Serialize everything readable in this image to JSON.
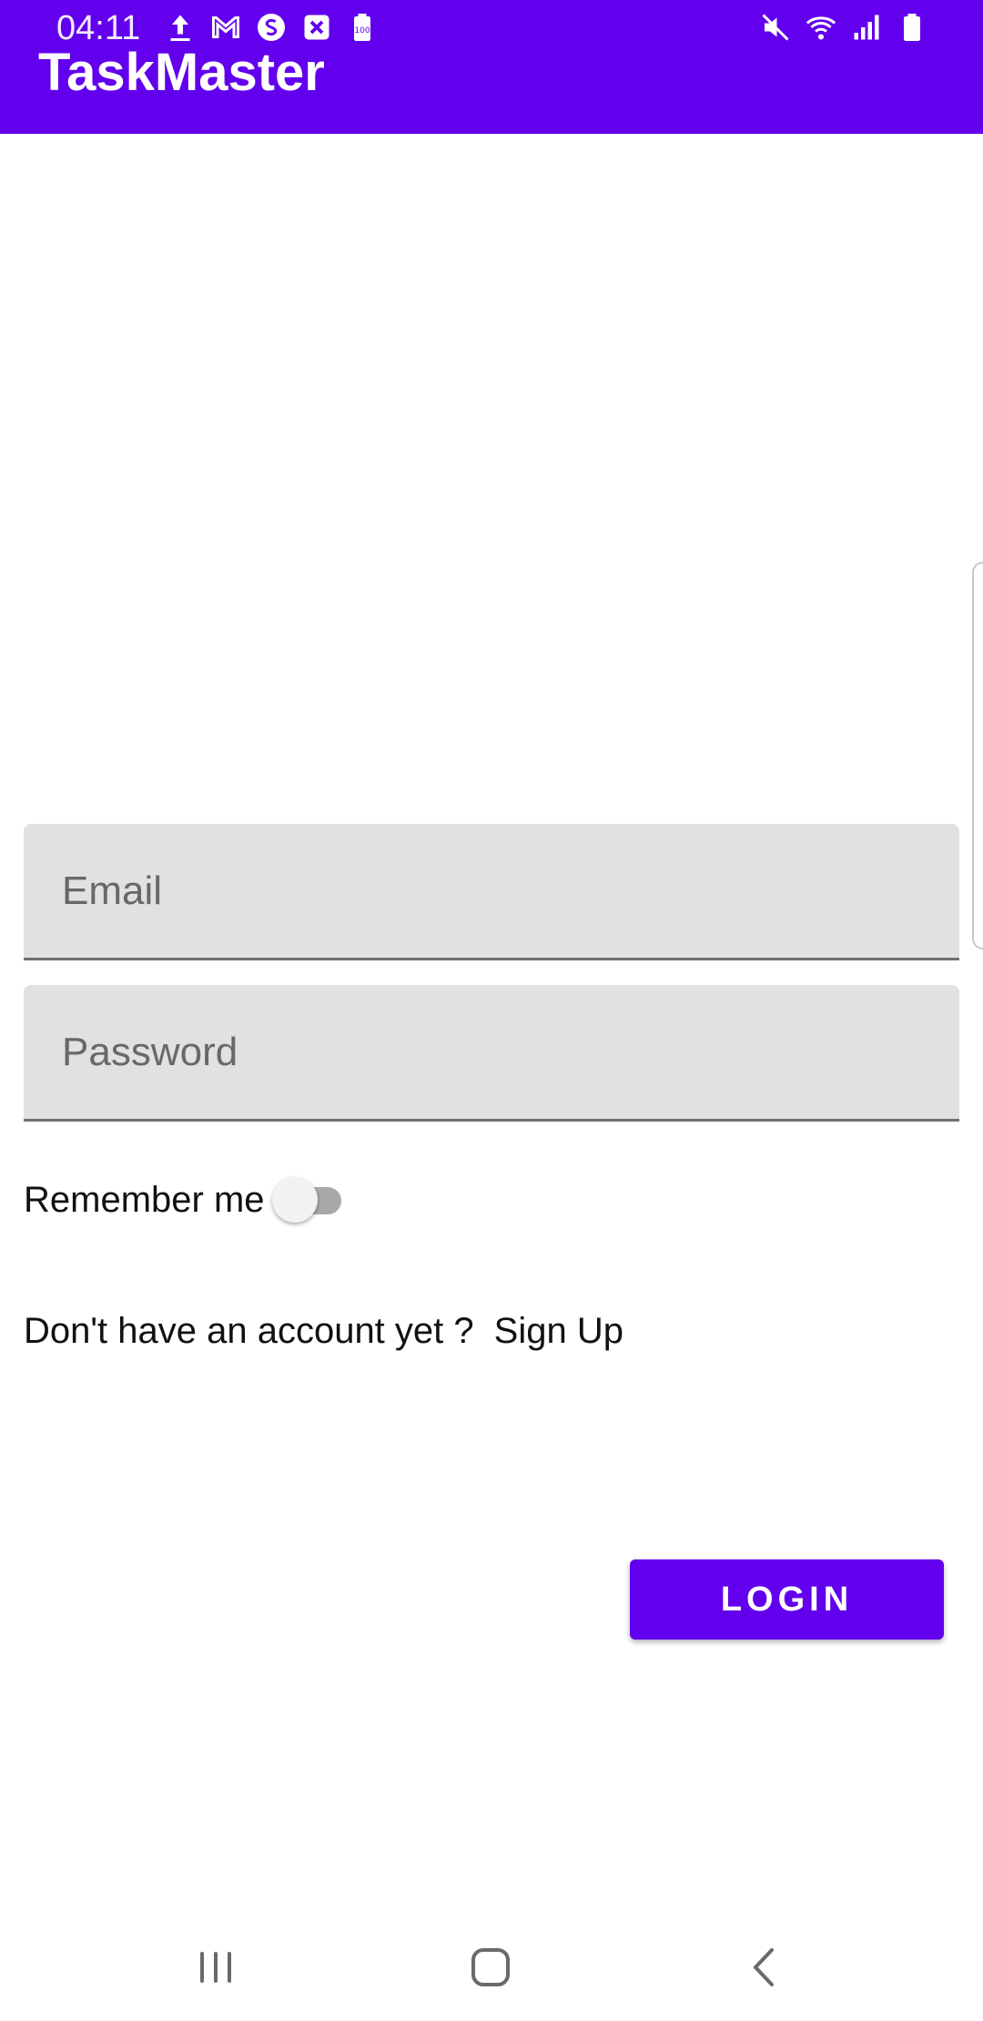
{
  "status_bar": {
    "time": "04:11",
    "left_icons": [
      "upload-icon",
      "gmail-icon",
      "sync-icon",
      "close-box-icon",
      "battery-saver-icon"
    ],
    "right_icons": [
      "mute-icon",
      "wifi-icon",
      "signal-icon",
      "battery-icon"
    ]
  },
  "app_bar": {
    "title": "TaskMaster",
    "color": "#6200ee"
  },
  "form": {
    "email_placeholder": "Email",
    "email_value": "",
    "password_placeholder": "Password",
    "password_value": "",
    "remember_label": "Remember me",
    "remember_on": false,
    "signup_prompt": "Don't have an account yet ?",
    "signup_link": "Sign Up",
    "login_label": "LOGIN"
  },
  "nav_bar": {
    "icons": [
      "recent-apps-icon",
      "home-icon",
      "back-icon"
    ]
  },
  "colors": {
    "accent": "#6200ee",
    "field_background": "#e1e1e1"
  }
}
